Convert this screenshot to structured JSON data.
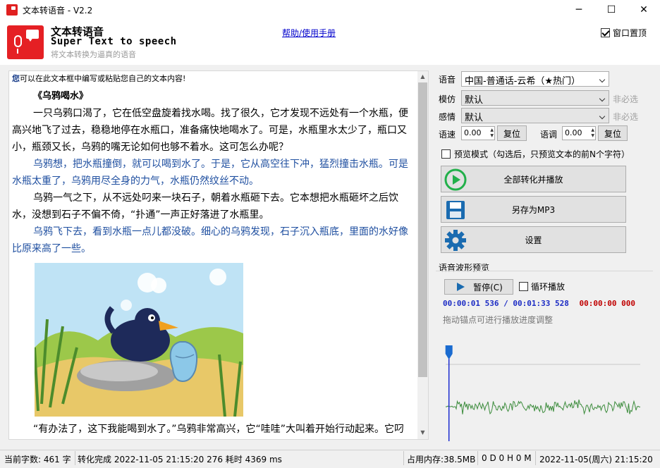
{
  "window": {
    "title": "文本转语音 - V2.2",
    "minimize_glyph": "─",
    "maximize_glyph": "☐",
    "close_glyph": "✕"
  },
  "header": {
    "title": "文本转语音",
    "subtitle": "Super Text to speech",
    "description": "将文本转换为逼真的语音",
    "help_link": "帮助/使用手册",
    "topmost_label": "窗口置顶",
    "topmost_checked": true,
    "logo_color": "#e52024"
  },
  "editor": {
    "hint_prefix": "您",
    "hint_text": "可以在此文本框中编写或粘贴您自己的文本内容!",
    "story_title": "《乌鸦喝水》",
    "paragraphs": [
      "一只乌鸦口渴了，它在低空盘旋着找水喝。找了很久，它才发现不远处有一个水瓶，便高兴地飞了过去，稳稳地停在水瓶口，准备痛快地喝水了。可是，水瓶里水太少了，瓶口又小，瓶颈又长，乌鸦的嘴无论如何也够不着水。这可怎么办呢？",
      "乌鸦想，把水瓶撞倒，就可以喝到水了。于是，它从高空往下冲，猛烈撞击水瓶。可是水瓶太重了，乌鸦用尽全身的力气，水瓶仍然纹丝不动。",
      "乌鸦一气之下，从不远处叼来一块石子，朝着水瓶砸下去。它本想把水瓶砸坏之后饮水，没想到石子不偏不倚，“扑通”一声正好落进了水瓶里。",
      "乌鸦飞下去，看到水瓶一点儿都没破。细心的乌鸦发现，石子沉入瓶底，里面的水好像比原来高了一些。",
      "“有办法了，这下我能喝到水了。”乌鸦非常高兴，它“哇哇”大叫着开始行动起来。它叼来许多石子，把它们一块一块地投到水瓶里。随着石子的增多，水瓶里的水也一点儿一"
    ]
  },
  "settings": {
    "voice_label": "语音",
    "voice_value": "中国-普通话-云希（★热门）",
    "imitate_label": "模仿",
    "imitate_value": "默认",
    "emotion_label": "感情",
    "emotion_value": "默认",
    "optional_text": "非必选",
    "speed_label": "语速",
    "speed_value": "0.00",
    "pitch_label": "语调",
    "pitch_value": "0.00",
    "reset_label": "复位",
    "preview_mode_label": "预览模式（勾选后，只预览文本的前N个字符）",
    "preview_mode_checked": false
  },
  "actions": {
    "convert_label": "全部转化并播放",
    "save_label": "另存为MP3",
    "settings_label": "设置"
  },
  "waveform": {
    "section_label": "语音波形预览",
    "pause_label": "暂停(C)",
    "loop_label": "循环播放",
    "loop_checked": false,
    "current_time": "00:00:01 536",
    "separator": "/",
    "total_time": "00:01:33 528",
    "extra_time": "00:00:00 000",
    "drag_hint": "拖动锚点可进行播放进度调整",
    "progress_fraction": 0.017,
    "wave_color": "#3c8c3c"
  },
  "status": {
    "char_count": "当前字数: 461 字",
    "conversion": "转化完成 2022-11-05 21:15:20 276 耗时 4369 ms",
    "memory": "占用内存:38.5MB",
    "uptime": "0 D 0 H 0 M",
    "datetime": "2022-11-05(周六) 21:15:20"
  }
}
